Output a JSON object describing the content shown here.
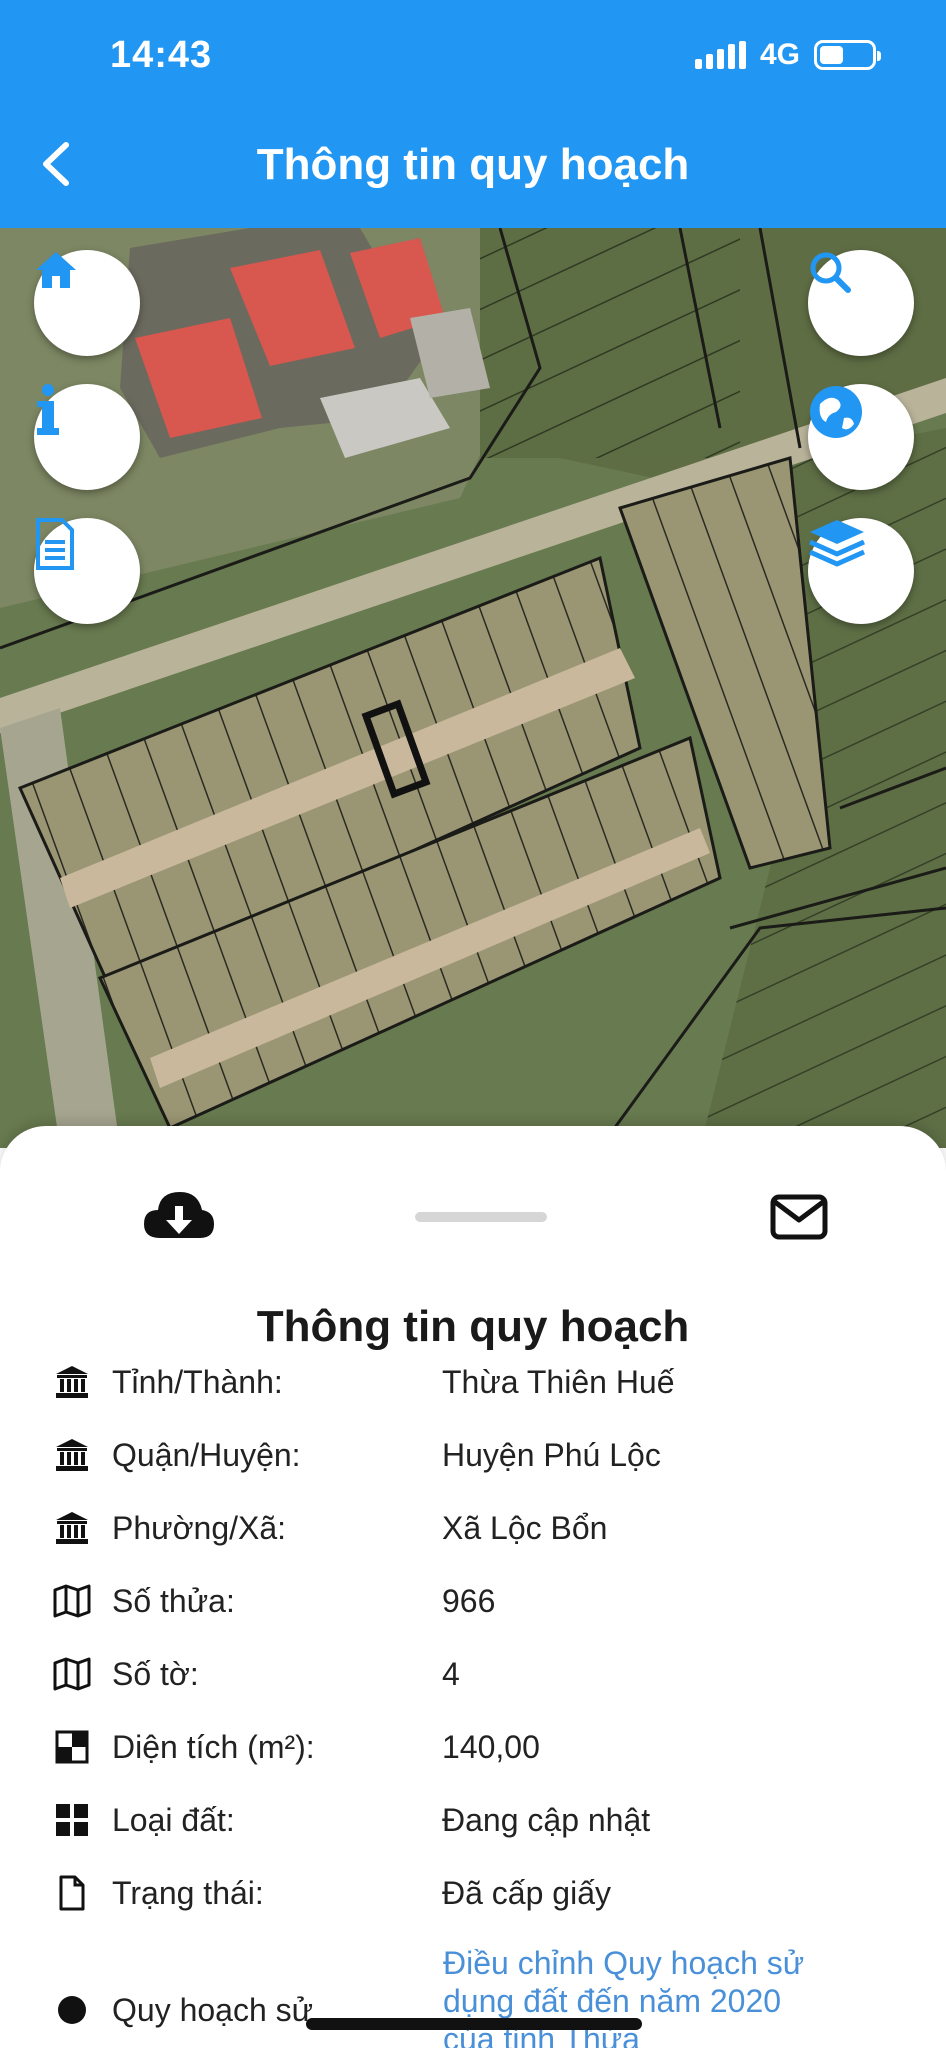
{
  "status_bar": {
    "time": "14:43",
    "network": "4G"
  },
  "header": {
    "title": "Thông tin quy hoạch"
  },
  "map_buttons": {
    "left": [
      "home-icon",
      "info-icon",
      "document-icon"
    ],
    "right": [
      "search-icon",
      "globe-icon",
      "layers-icon"
    ]
  },
  "sheet": {
    "title": "Thông tin quy hoạch",
    "rows": [
      {
        "icon": "bank-icon",
        "label": "Tỉnh/Thành:",
        "value": "Thừa Thiên Huế"
      },
      {
        "icon": "bank-icon",
        "label": "Quận/Huyện:",
        "value": "Huyện Phú Lộc"
      },
      {
        "icon": "bank-icon",
        "label": "Phường/Xã:",
        "value": "Xã Lộc Bổn"
      },
      {
        "icon": "map-icon",
        "label": "Số thửa:",
        "value": "966"
      },
      {
        "icon": "map-icon",
        "label": "Số tờ:",
        "value": "4"
      },
      {
        "icon": "area-icon",
        "label": "Diện tích (m²):",
        "value": "140,00"
      },
      {
        "icon": "grid-icon",
        "label": "Loại đất:",
        "value": "Đang cập nhật"
      },
      {
        "icon": "file-icon",
        "label": "Trạng thái:",
        "value": "Đã cấp giấy"
      }
    ],
    "plan_label": "Quy hoạch sử",
    "plan_value_lines": [
      "Điều chỉnh Quy hoạch sử",
      "dụng đất đến năm 2020",
      "của tỉnh Thừa"
    ]
  },
  "colors": {
    "primary": "#2196f3",
    "link": "#4a90d9"
  }
}
